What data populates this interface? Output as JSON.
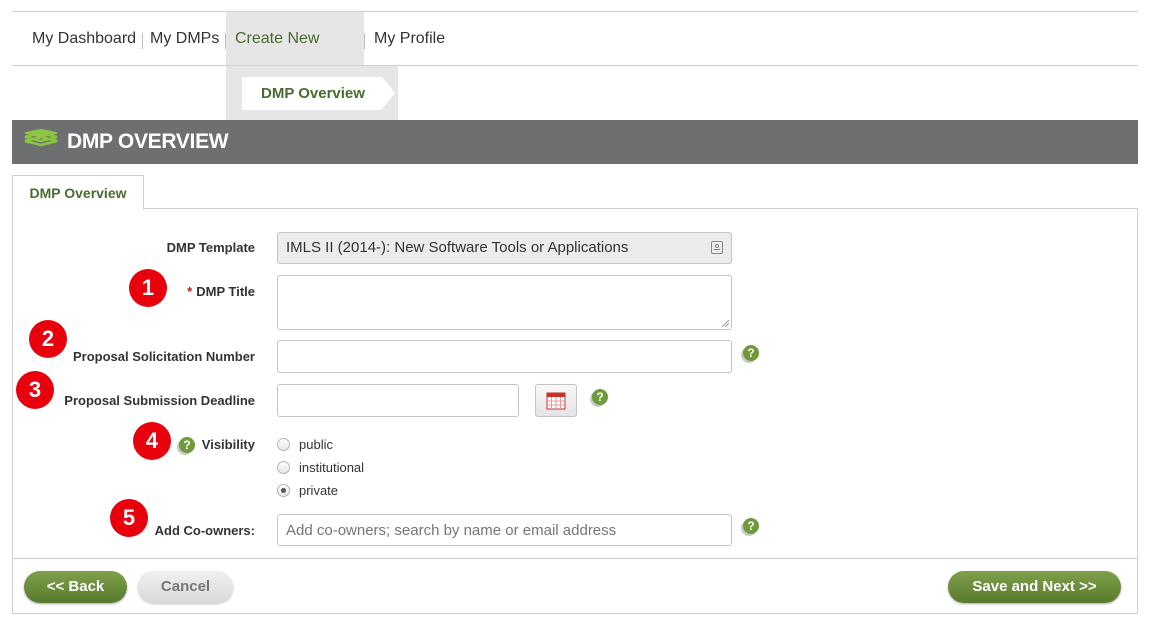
{
  "nav": {
    "items": [
      {
        "label": "My Dashboard"
      },
      {
        "label": "My DMPs"
      },
      {
        "label": "Create New DMP"
      },
      {
        "label": "My Profile"
      }
    ]
  },
  "breadcrumb": {
    "label": "DMP Overview"
  },
  "banner": {
    "title": "DMP OVERVIEW",
    "icon": "layers-icon"
  },
  "tab": {
    "label": "DMP Overview"
  },
  "form": {
    "template": {
      "label": "DMP Template",
      "value": "IMLS II (2014-): New Software Tools or Applications"
    },
    "title": {
      "required_mark": "*",
      "label": "DMP Title",
      "value": ""
    },
    "solicitation": {
      "label": "Proposal Solicitation Number",
      "value": ""
    },
    "deadline": {
      "label": "Proposal Submission Deadline",
      "value": ""
    },
    "visibility": {
      "label": "Visibility",
      "options": [
        {
          "label": "public",
          "checked": false
        },
        {
          "label": "institutional",
          "checked": false
        },
        {
          "label": "private",
          "checked": true
        }
      ]
    },
    "coowners": {
      "label": "Add Co-owners:",
      "placeholder": "Add co-owners; search by name or email address"
    }
  },
  "help_icon": "?",
  "badges": [
    "1",
    "2",
    "3",
    "4",
    "5"
  ],
  "buttons": {
    "back": "<< Back",
    "cancel": "Cancel",
    "save_next": "Save and Next >>"
  },
  "colors": {
    "accent_green": "#587a2d",
    "banner_grey": "#6e6f70",
    "badge_red": "#e8000d",
    "active_nav": "#4a6b2f"
  }
}
